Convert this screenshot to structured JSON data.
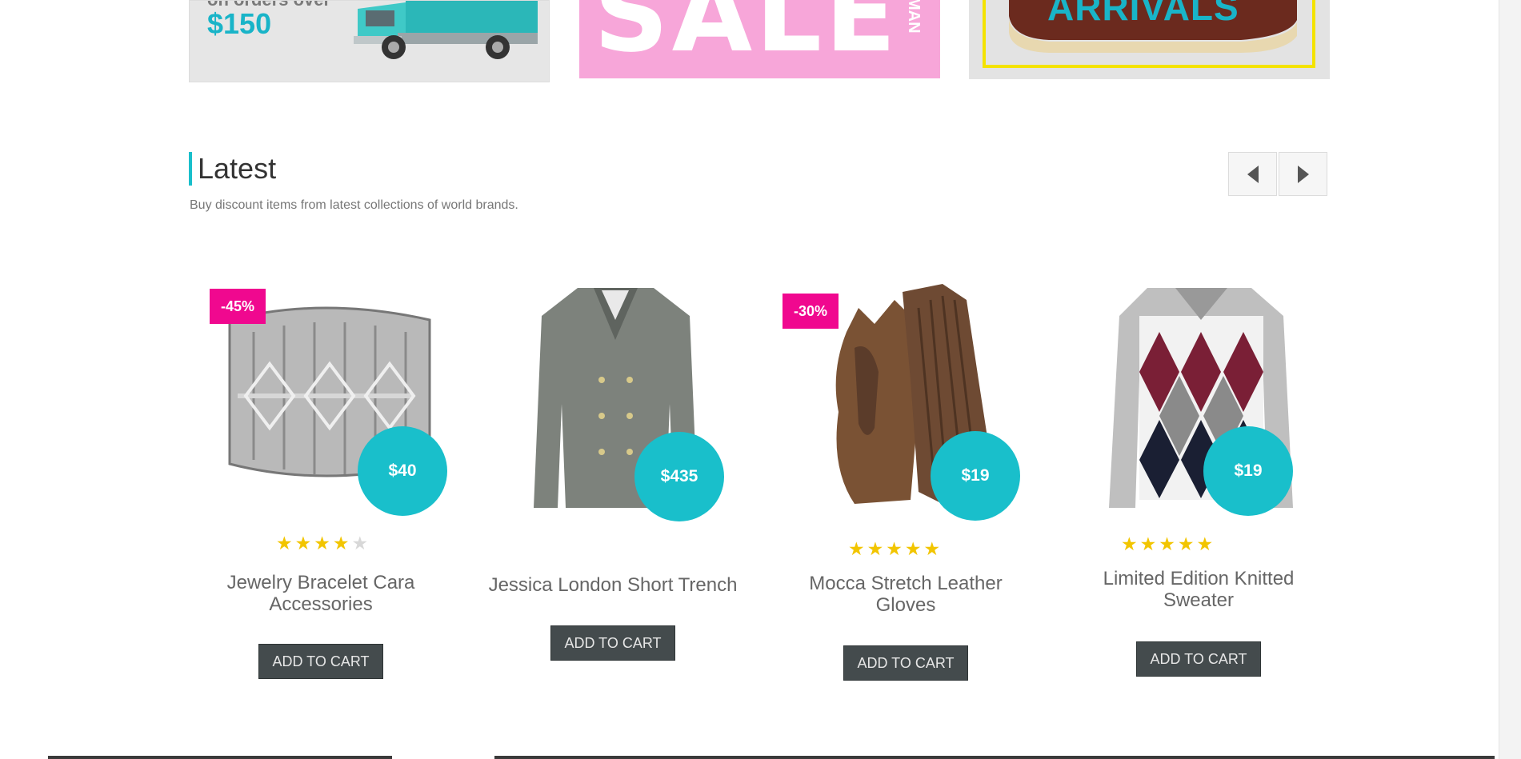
{
  "banners": {
    "shipping": {
      "line1": "on orders over",
      "amount": "$150"
    },
    "sale": {
      "word": "SALE",
      "side_text": "MAN"
    },
    "arrivals": {
      "word": "ARRIVALS"
    }
  },
  "section": {
    "title": "Latest",
    "subtitle": "Buy discount items from latest collections of world brands."
  },
  "colors": {
    "accent": "#19bfcb",
    "discount": "#f0088f",
    "cart_button": "#444b4d",
    "star": "#f2c500"
  },
  "nav": {
    "prev_icon": "triangle-left-icon",
    "next_icon": "triangle-right-icon"
  },
  "products": [
    {
      "name": "Jewelry Bracelet Cara Accessories",
      "price": "$40",
      "discount": "-45%",
      "rating": 4,
      "cart": "ADD TO CART"
    },
    {
      "name": "Jessica London Short Trench",
      "price": "$435",
      "discount": "",
      "rating": 0,
      "cart": "ADD TO CART"
    },
    {
      "name": "Mocca Stretch Leather Gloves",
      "price": "$19",
      "discount": "-30%",
      "rating": 5,
      "cart": "ADD TO CART"
    },
    {
      "name": "Limited Edition Knitted Sweater",
      "price": "$19",
      "discount": "",
      "rating": 5,
      "cart": "ADD TO CART"
    }
  ]
}
